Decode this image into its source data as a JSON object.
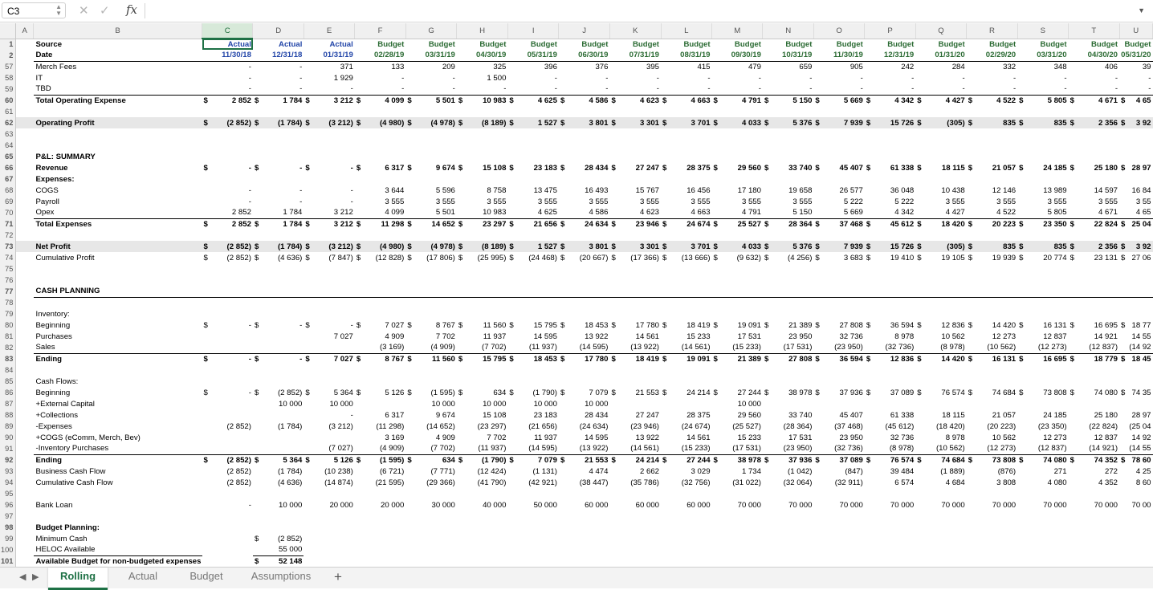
{
  "formula_bar": {
    "cell_ref": "C3",
    "cancel_icon": "✕",
    "confirm_icon": "✓",
    "fx_label": "fx",
    "formula": ""
  },
  "sheet": {
    "columns": [
      "A",
      "B",
      "C",
      "D",
      "E",
      "F",
      "G",
      "H",
      "I",
      "J",
      "K",
      "L",
      "M",
      "N",
      "O",
      "P",
      "Q",
      "R",
      "S",
      "T",
      "U"
    ],
    "selected_column": "C",
    "rows": [
      {
        "n": "1",
        "label": "Source",
        "style": "hdr",
        "v": [
          "Actual",
          "Actual",
          "Actual",
          "Budget",
          "Budget",
          "Budget",
          "Budget",
          "Budget",
          "Budget",
          "Budget",
          "Budget",
          "Budget",
          "Budget",
          "Budget",
          "Budget",
          "Budget",
          "Budget",
          "Budget",
          "Budget"
        ]
      },
      {
        "n": "2",
        "label": "Date",
        "style": "hdr2",
        "v": [
          "11/30/18",
          "12/31/18",
          "01/31/19",
          "02/28/19",
          "03/31/19",
          "04/30/19",
          "05/31/19",
          "06/30/19",
          "07/31/19",
          "08/31/19",
          "09/30/19",
          "10/31/19",
          "11/30/19",
          "12/31/19",
          "01/31/20",
          "02/29/20",
          "03/31/20",
          "04/30/20",
          "05/31/20"
        ]
      },
      {
        "n": "57",
        "label": "Merch Fees",
        "style": "",
        "d": [],
        "v": [
          "-",
          "-",
          "371",
          "133",
          "209",
          "325",
          "396",
          "376",
          "395",
          "415",
          "479",
          "659",
          "905",
          "242",
          "284",
          "332",
          "348",
          "406",
          "39"
        ]
      },
      {
        "n": "58",
        "label": "IT",
        "style": "",
        "d": [],
        "v": [
          "-",
          "-",
          "1 929",
          "-",
          "-",
          "1 500",
          "-",
          "-",
          "-",
          "-",
          "-",
          "-",
          "-",
          "-",
          "-",
          "-",
          "-",
          "-",
          "-"
        ]
      },
      {
        "n": "59",
        "label": "TBD",
        "style": "ul",
        "d": [],
        "v": [
          "-",
          "-",
          "-",
          "-",
          "-",
          "-",
          "-",
          "-",
          "-",
          "-",
          "-",
          "-",
          "-",
          "-",
          "-",
          "-",
          "-",
          "-",
          "-"
        ]
      },
      {
        "n": "60",
        "label": "Total Operating Expense",
        "style": "bold",
        "d": "all",
        "v": [
          "2 852",
          "1 784",
          "3 212",
          "4 099",
          "5 501",
          "10 983",
          "4 625",
          "4 586",
          "4 623",
          "4 663",
          "4 791",
          "5 150",
          "5 669",
          "4 342",
          "4 427",
          "4 522",
          "5 805",
          "4 671",
          "4 65"
        ]
      },
      {
        "n": "61",
        "label": "",
        "style": "",
        "v": []
      },
      {
        "n": "62",
        "label": "Operating Profit",
        "style": "bold band",
        "d": "all",
        "v": [
          "(2 852)",
          "(1 784)",
          "(3 212)",
          "(4 980)",
          "(4 978)",
          "(8 189)",
          "1 527",
          "3 801",
          "3 301",
          "3 701",
          "4 033",
          "5 376",
          "7 939",
          "15 726",
          "(305)",
          "835",
          "835",
          "2 356",
          "3 92"
        ]
      },
      {
        "n": "63",
        "label": "",
        "style": "",
        "v": []
      },
      {
        "n": "64",
        "label": "",
        "style": "",
        "v": []
      },
      {
        "n": "65",
        "label": "P&L: SUMMARY",
        "style": "bold",
        "v": []
      },
      {
        "n": "66",
        "label": "Revenue",
        "style": "bold",
        "d": "all",
        "v": [
          "-",
          "-",
          "-",
          "6 317",
          "9 674",
          "15 108",
          "23 183",
          "28 434",
          "27 247",
          "28 375",
          "29 560",
          "33 740",
          "45 407",
          "61 338",
          "18 115",
          "21 057",
          "24 185",
          "25 180",
          "28 97"
        ]
      },
      {
        "n": "67",
        "label": "Expenses:",
        "style": "bold",
        "v": []
      },
      {
        "n": "68",
        "label": "COGS",
        "style": "",
        "v": [
          "-",
          "-",
          "-",
          "3 644",
          "5 596",
          "8 758",
          "13 475",
          "16 493",
          "15 767",
          "16 456",
          "17 180",
          "19 658",
          "26 577",
          "36 048",
          "10 438",
          "12 146",
          "13 989",
          "14 597",
          "16 84"
        ]
      },
      {
        "n": "69",
        "label": "Payroll",
        "style": "",
        "v": [
          "-",
          "-",
          "-",
          "3 555",
          "3 555",
          "3 555",
          "3 555",
          "3 555",
          "3 555",
          "3 555",
          "3 555",
          "3 555",
          "5 222",
          "5 222",
          "3 555",
          "3 555",
          "3 555",
          "3 555",
          "3 55"
        ]
      },
      {
        "n": "70",
        "label": "Opex",
        "style": "ul",
        "v": [
          "2 852",
          "1 784",
          "3 212",
          "4 099",
          "5 501",
          "10 983",
          "4 625",
          "4 586",
          "4 623",
          "4 663",
          "4 791",
          "5 150",
          "5 669",
          "4 342",
          "4 427",
          "4 522",
          "5 805",
          "4 671",
          "4 65"
        ]
      },
      {
        "n": "71",
        "label": "Total Expenses",
        "style": "bold",
        "d": "all",
        "v": [
          "2 852",
          "1 784",
          "3 212",
          "11 298",
          "14 652",
          "23 297",
          "21 656",
          "24 634",
          "23 946",
          "24 674",
          "25 527",
          "28 364",
          "37 468",
          "45 612",
          "18 420",
          "20 223",
          "23 350",
          "22 824",
          "25 04"
        ]
      },
      {
        "n": "72",
        "label": "",
        "style": "",
        "v": []
      },
      {
        "n": "73",
        "label": "Net Profit",
        "style": "bold band",
        "d": "all",
        "v": [
          "(2 852)",
          "(1 784)",
          "(3 212)",
          "(4 980)",
          "(4 978)",
          "(8 189)",
          "1 527",
          "3 801",
          "3 301",
          "3 701",
          "4 033",
          "5 376",
          "7 939",
          "15 726",
          "(305)",
          "835",
          "835",
          "2 356",
          "3 92"
        ]
      },
      {
        "n": "74",
        "label": "Cumulative Profit",
        "style": "",
        "d": "all",
        "v": [
          "(2 852)",
          "(4 636)",
          "(7 847)",
          "(12 828)",
          "(17 806)",
          "(25 995)",
          "(24 468)",
          "(20 667)",
          "(17 366)",
          "(13 666)",
          "(9 632)",
          "(4 256)",
          "3 683",
          "19 410",
          "19 105",
          "19 939",
          "20 774",
          "23 131",
          "27 06"
        ]
      },
      {
        "n": "75",
        "label": "",
        "style": "",
        "v": []
      },
      {
        "n": "76",
        "label": "",
        "style": "",
        "v": []
      },
      {
        "n": "77",
        "label": "CASH PLANNING",
        "style": "bold ul",
        "v": []
      },
      {
        "n": "78",
        "label": "",
        "style": "",
        "v": []
      },
      {
        "n": "79",
        "label": "Inventory:",
        "style": "",
        "v": []
      },
      {
        "n": "80",
        "label": "Beginning",
        "style": "",
        "d": "all",
        "v": [
          "-",
          "-",
          "-",
          "7 027",
          "8 767",
          "11 560",
          "15 795",
          "18 453",
          "17 780",
          "18 419",
          "19 091",
          "21 389",
          "27 808",
          "36 594",
          "12 836",
          "14 420",
          "16 131",
          "16 695",
          "18 77"
        ]
      },
      {
        "n": "81",
        "label": "Purchases",
        "style": "",
        "v": [
          "",
          "",
          "7 027",
          "4 909",
          "7 702",
          "11 937",
          "14 595",
          "13 922",
          "14 561",
          "15 233",
          "17 531",
          "23 950",
          "32 736",
          "8 978",
          "10 562",
          "12 273",
          "12 837",
          "14 921",
          "14 55"
        ]
      },
      {
        "n": "82",
        "label": "Sales",
        "style": "ul",
        "v": [
          "",
          "",
          "",
          "(3 169)",
          "(4 909)",
          "(7 702)",
          "(11 937)",
          "(14 595)",
          "(13 922)",
          "(14 561)",
          "(15 233)",
          "(17 531)",
          "(23 950)",
          "(32 736)",
          "(8 978)",
          "(10 562)",
          "(12 273)",
          "(12 837)",
          "(14 92"
        ]
      },
      {
        "n": "83",
        "label": "Ending",
        "style": "bold",
        "d": "all",
        "v": [
          "-",
          "-",
          "7 027",
          "8 767",
          "11 560",
          "15 795",
          "18 453",
          "17 780",
          "18 419",
          "19 091",
          "21 389",
          "27 808",
          "36 594",
          "12 836",
          "14 420",
          "16 131",
          "16 695",
          "18 779",
          "18 45"
        ]
      },
      {
        "n": "84",
        "label": "",
        "style": "",
        "v": []
      },
      {
        "n": "85",
        "label": "Cash Flows:",
        "style": "",
        "v": []
      },
      {
        "n": "86",
        "label": "Beginning",
        "style": "",
        "d": "all",
        "v": [
          "-",
          "(2 852)",
          "5 364",
          "5 126",
          "(1 595)",
          "634",
          "(1 790)",
          "7 079",
          "21 553",
          "24 214",
          "27 244",
          "38 978",
          "37 936",
          "37 089",
          "76 574",
          "74 684",
          "73 808",
          "74 080",
          "74 35"
        ]
      },
      {
        "n": "87",
        "label": "+External Capital",
        "style": "",
        "v": [
          "",
          "10 000",
          "10 000",
          "",
          "10 000",
          "10 000",
          "10 000",
          "10 000",
          "",
          "",
          "10 000",
          "",
          "",
          "",
          "",
          "",
          "",
          "",
          ""
        ]
      },
      {
        "n": "88",
        "label": "+Collections",
        "style": "",
        "v": [
          "",
          "",
          "-",
          "6 317",
          "9 674",
          "15 108",
          "23 183",
          "28 434",
          "27 247",
          "28 375",
          "29 560",
          "33 740",
          "45 407",
          "61 338",
          "18 115",
          "21 057",
          "24 185",
          "25 180",
          "28 97"
        ]
      },
      {
        "n": "89",
        "label": "-Expenses",
        "style": "",
        "v": [
          "(2 852)",
          "(1 784)",
          "(3 212)",
          "(11 298)",
          "(14 652)",
          "(23 297)",
          "(21 656)",
          "(24 634)",
          "(23 946)",
          "(24 674)",
          "(25 527)",
          "(28 364)",
          "(37 468)",
          "(45 612)",
          "(18 420)",
          "(20 223)",
          "(23 350)",
          "(22 824)",
          "(25 04"
        ]
      },
      {
        "n": "90",
        "label": "+COGS (eComm, Merch, Bev)",
        "style": "",
        "v": [
          "",
          "",
          "",
          "3 169",
          "4 909",
          "7 702",
          "11 937",
          "14 595",
          "13 922",
          "14 561",
          "15 233",
          "17 531",
          "23 950",
          "32 736",
          "8 978",
          "10 562",
          "12 273",
          "12 837",
          "14 92"
        ]
      },
      {
        "n": "91",
        "label": "-Inventory Purchases",
        "style": "ul",
        "v": [
          "",
          "",
          "(7 027)",
          "(4 909)",
          "(7 702)",
          "(11 937)",
          "(14 595)",
          "(13 922)",
          "(14 561)",
          "(15 233)",
          "(17 531)",
          "(23 950)",
          "(32 736)",
          "(8 978)",
          "(10 562)",
          "(12 273)",
          "(12 837)",
          "(14 921)",
          "(14 55"
        ]
      },
      {
        "n": "92",
        "label": "Ending",
        "style": "bold",
        "d": "all",
        "v": [
          "(2 852)",
          "5 364",
          "5 126",
          "(1 595)",
          "634",
          "(1 790)",
          "7 079",
          "21 553",
          "24 214",
          "27 244",
          "38 978",
          "37 936",
          "37 089",
          "76 574",
          "74 684",
          "73 808",
          "74 080",
          "74 352",
          "78 60"
        ]
      },
      {
        "n": "93",
        "label": "Business Cash Flow",
        "style": "",
        "v": [
          "(2 852)",
          "(1 784)",
          "(10 238)",
          "(6 721)",
          "(7 771)",
          "(12 424)",
          "(1 131)",
          "4 474",
          "2 662",
          "3 029",
          "1 734",
          "(1 042)",
          "(847)",
          "39 484",
          "(1 889)",
          "(876)",
          "271",
          "272",
          "4 25"
        ]
      },
      {
        "n": "94",
        "label": "Cumulative Cash Flow",
        "style": "",
        "v": [
          "(2 852)",
          "(4 636)",
          "(14 874)",
          "(21 595)",
          "(29 366)",
          "(41 790)",
          "(42 921)",
          "(38 447)",
          "(35 786)",
          "(32 756)",
          "(31 022)",
          "(32 064)",
          "(32 911)",
          "6 574",
          "4 684",
          "3 808",
          "4 080",
          "4 352",
          "8 60"
        ]
      },
      {
        "n": "95",
        "label": "",
        "style": "",
        "v": []
      },
      {
        "n": "96",
        "label": "Bank Loan",
        "style": "",
        "v": [
          "-",
          "10 000",
          "20 000",
          "20 000",
          "30 000",
          "40 000",
          "50 000",
          "60 000",
          "60 000",
          "60 000",
          "70 000",
          "70 000",
          "70 000",
          "70 000",
          "70 000",
          "70 000",
          "70 000",
          "70 000",
          "70 00"
        ]
      },
      {
        "n": "97",
        "label": "",
        "style": "",
        "v": []
      },
      {
        "n": "98",
        "label": "Budget Planning:",
        "style": "bold",
        "v": []
      },
      {
        "n": "99",
        "label": "Minimum Cash",
        "style": "",
        "d": [
          1
        ],
        "v": [
          "",
          "(2 852)"
        ]
      },
      {
        "n": "100",
        "label": "HELOC Available",
        "style": "ul",
        "v": [
          "",
          "55 000"
        ]
      },
      {
        "n": "101",
        "label": "Available Budget for non-budgeted expenses",
        "style": "bold",
        "d": [
          1
        ],
        "v": [
          "",
          "52 148"
        ]
      }
    ]
  },
  "tabs": [
    {
      "label": "Rolling",
      "active": true
    },
    {
      "label": "Actual",
      "active": false
    },
    {
      "label": "Budget",
      "active": false
    },
    {
      "label": "Assumptions",
      "active": false
    }
  ],
  "add_sheet": "+",
  "currency": "$"
}
